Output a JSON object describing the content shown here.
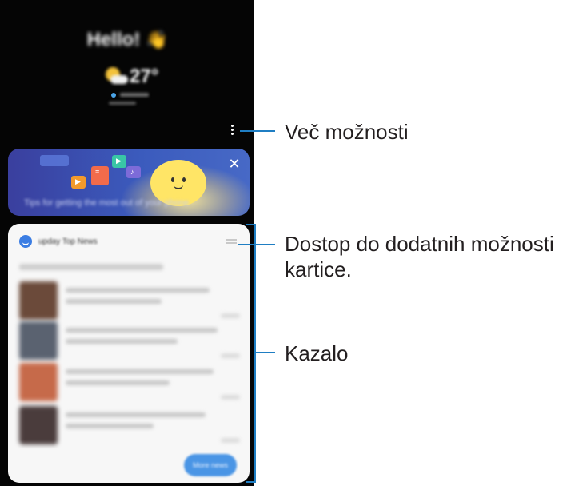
{
  "home": {
    "greeting": "Hello!",
    "wave_emoji": "👋",
    "temperature": "27°"
  },
  "banner": {
    "tip_text": "Tips for getting the most out of your phone",
    "close_symbol": "✕"
  },
  "news_card": {
    "source_title": "upday Top News",
    "more_button": "More news"
  },
  "callouts": {
    "more_options": "Več možnosti",
    "card_options_line1": "Dostop do dodatnih možnosti",
    "card_options_line2": "kartice.",
    "index": "Kazalo"
  },
  "colors": {
    "callout_line": "#1f7ec3",
    "phone_background": "#050505",
    "banner_accent": "#3b5bbd",
    "upday_blue": "#3b7de3"
  },
  "icons": [
    "wave-emoji-icon",
    "weather-sun-cloud-icon",
    "location-pin-icon",
    "more-options-icon",
    "close-icon",
    "upday-logo-icon",
    "card-options-icon"
  ]
}
